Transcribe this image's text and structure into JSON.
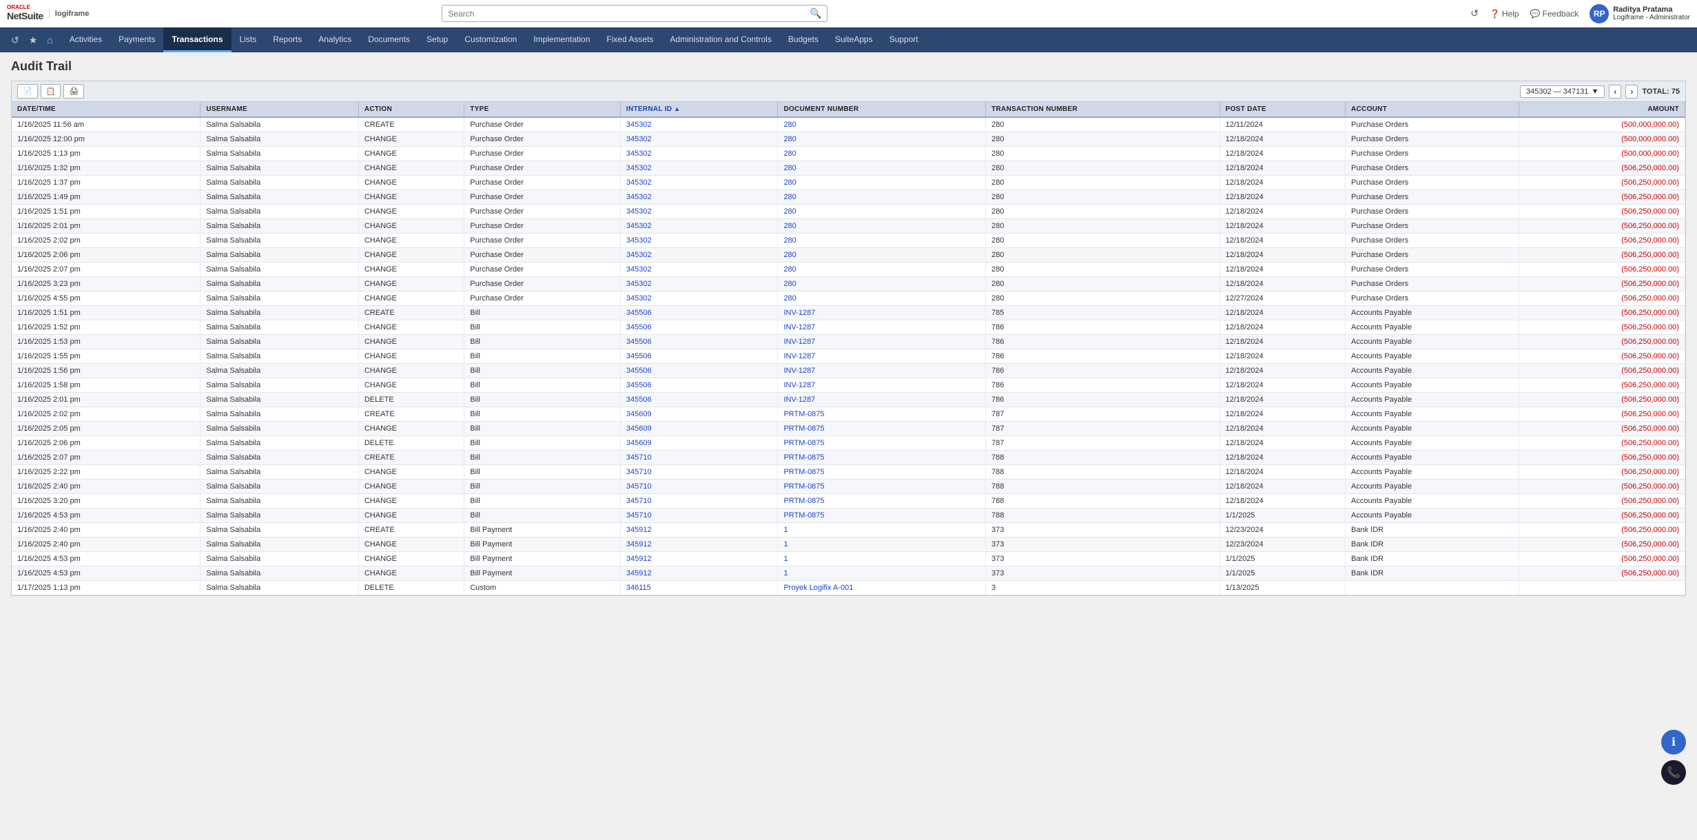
{
  "app": {
    "oracle_label": "ORACLE",
    "netsuite_label": "NetSuite",
    "logiframe_label": "logiframe"
  },
  "topbar": {
    "search_placeholder": "Search",
    "help_label": "Help",
    "feedback_label": "Feedback",
    "user_name": "Raditya Pratama",
    "user_role": "Logiframe - Administrator",
    "user_initials": "RP"
  },
  "nav": {
    "items": [
      {
        "id": "home",
        "label": "🏠",
        "is_icon": true
      },
      {
        "id": "activities",
        "label": "Activities"
      },
      {
        "id": "payments",
        "label": "Payments"
      },
      {
        "id": "transactions",
        "label": "Transactions",
        "active": true
      },
      {
        "id": "lists",
        "label": "Lists"
      },
      {
        "id": "reports",
        "label": "Reports"
      },
      {
        "id": "analytics",
        "label": "Analytics"
      },
      {
        "id": "documents",
        "label": "Documents"
      },
      {
        "id": "setup",
        "label": "Setup"
      },
      {
        "id": "customization",
        "label": "Customization"
      },
      {
        "id": "implementation",
        "label": "Implementation"
      },
      {
        "id": "fixed-assets",
        "label": "Fixed Assets"
      },
      {
        "id": "admin",
        "label": "Administration and Controls"
      },
      {
        "id": "budgets",
        "label": "Budgets"
      },
      {
        "id": "suiteapps",
        "label": "SuiteApps"
      },
      {
        "id": "support",
        "label": "Support"
      }
    ]
  },
  "page": {
    "title": "Audit Trail"
  },
  "toolbar": {
    "btn1_icon": "📄",
    "btn2_icon": "📋",
    "btn3_icon": "🖨",
    "page_range": "345302 — 347131",
    "total_label": "TOTAL: 75"
  },
  "table": {
    "columns": [
      {
        "id": "datetime",
        "label": "DATE/TIME",
        "sort": false
      },
      {
        "id": "username",
        "label": "USERNAME",
        "sort": false
      },
      {
        "id": "action",
        "label": "ACTION",
        "sort": false
      },
      {
        "id": "type",
        "label": "TYPE",
        "sort": false
      },
      {
        "id": "internal_id",
        "label": "INTERNAL ID",
        "sort": true
      },
      {
        "id": "document_number",
        "label": "DOCUMENT NUMBER",
        "sort": false
      },
      {
        "id": "transaction_number",
        "label": "TRANSACTION NUMBER",
        "sort": false
      },
      {
        "id": "post_date",
        "label": "POST DATE",
        "sort": false
      },
      {
        "id": "account",
        "label": "ACCOUNT",
        "sort": false
      },
      {
        "id": "amount",
        "label": "AMOUNT",
        "sort": false,
        "right": true
      }
    ],
    "rows": [
      {
        "datetime": "1/16/2025 11:56 am",
        "username": "Salma Salsabila",
        "action": "CREATE",
        "type": "Purchase Order",
        "internal_id": "345302",
        "document_number": "280",
        "transaction_number": "280",
        "post_date": "12/11/2024",
        "account": "Purchase Orders",
        "amount": "(500,000,000.00)"
      },
      {
        "datetime": "1/16/2025 12:00 pm",
        "username": "Salma Salsabila",
        "action": "CHANGE",
        "type": "Purchase Order",
        "internal_id": "345302",
        "document_number": "280",
        "transaction_number": "280",
        "post_date": "12/18/2024",
        "account": "Purchase Orders",
        "amount": "(500,000,000.00)"
      },
      {
        "datetime": "1/16/2025 1:13 pm",
        "username": "Salma Salsabila",
        "action": "CHANGE",
        "type": "Purchase Order",
        "internal_id": "345302",
        "document_number": "280",
        "transaction_number": "280",
        "post_date": "12/18/2024",
        "account": "Purchase Orders",
        "amount": "(500,000,000.00)"
      },
      {
        "datetime": "1/16/2025 1:32 pm",
        "username": "Salma Salsabila",
        "action": "CHANGE",
        "type": "Purchase Order",
        "internal_id": "345302",
        "document_number": "280",
        "transaction_number": "280",
        "post_date": "12/18/2024",
        "account": "Purchase Orders",
        "amount": "(506,250,000.00)"
      },
      {
        "datetime": "1/16/2025 1:37 pm",
        "username": "Salma Salsabila",
        "action": "CHANGE",
        "type": "Purchase Order",
        "internal_id": "345302",
        "document_number": "280",
        "transaction_number": "280",
        "post_date": "12/18/2024",
        "account": "Purchase Orders",
        "amount": "(506,250,000.00)"
      },
      {
        "datetime": "1/16/2025 1:49 pm",
        "username": "Salma Salsabila",
        "action": "CHANGE",
        "type": "Purchase Order",
        "internal_id": "345302",
        "document_number": "280",
        "transaction_number": "280",
        "post_date": "12/18/2024",
        "account": "Purchase Orders",
        "amount": "(506,250,000.00)"
      },
      {
        "datetime": "1/16/2025 1:51 pm",
        "username": "Salma Salsabila",
        "action": "CHANGE",
        "type": "Purchase Order",
        "internal_id": "345302",
        "document_number": "280",
        "transaction_number": "280",
        "post_date": "12/18/2024",
        "account": "Purchase Orders",
        "amount": "(506,250,000.00)"
      },
      {
        "datetime": "1/16/2025 2:01 pm",
        "username": "Salma Salsabila",
        "action": "CHANGE",
        "type": "Purchase Order",
        "internal_id": "345302",
        "document_number": "280",
        "transaction_number": "280",
        "post_date": "12/18/2024",
        "account": "Purchase Orders",
        "amount": "(506,250,000.00)"
      },
      {
        "datetime": "1/16/2025 2:02 pm",
        "username": "Salma Salsabila",
        "action": "CHANGE",
        "type": "Purchase Order",
        "internal_id": "345302",
        "document_number": "280",
        "transaction_number": "280",
        "post_date": "12/18/2024",
        "account": "Purchase Orders",
        "amount": "(506,250,000.00)"
      },
      {
        "datetime": "1/16/2025 2:06 pm",
        "username": "Salma Salsabila",
        "action": "CHANGE",
        "type": "Purchase Order",
        "internal_id": "345302",
        "document_number": "280",
        "transaction_number": "280",
        "post_date": "12/18/2024",
        "account": "Purchase Orders",
        "amount": "(506,250,000.00)"
      },
      {
        "datetime": "1/16/2025 2:07 pm",
        "username": "Salma Salsabila",
        "action": "CHANGE",
        "type": "Purchase Order",
        "internal_id": "345302",
        "document_number": "280",
        "transaction_number": "280",
        "post_date": "12/18/2024",
        "account": "Purchase Orders",
        "amount": "(506,250,000.00)"
      },
      {
        "datetime": "1/16/2025 3:23 pm",
        "username": "Salma Salsabila",
        "action": "CHANGE",
        "type": "Purchase Order",
        "internal_id": "345302",
        "document_number": "280",
        "transaction_number": "280",
        "post_date": "12/18/2024",
        "account": "Purchase Orders",
        "amount": "(506,250,000.00)"
      },
      {
        "datetime": "1/16/2025 4:55 pm",
        "username": "Salma Salsabila",
        "action": "CHANGE",
        "type": "Purchase Order",
        "internal_id": "345302",
        "document_number": "280",
        "transaction_number": "280",
        "post_date": "12/27/2024",
        "account": "Purchase Orders",
        "amount": "(506,250,000.00)"
      },
      {
        "datetime": "1/16/2025 1:51 pm",
        "username": "Salma Salsabila",
        "action": "CREATE",
        "type": "Bill",
        "internal_id": "345506",
        "document_number": "INV-1287",
        "transaction_number": "785",
        "post_date": "12/18/2024",
        "account": "Accounts Payable",
        "amount": "(506,250,000.00)"
      },
      {
        "datetime": "1/16/2025 1:52 pm",
        "username": "Salma Salsabila",
        "action": "CHANGE",
        "type": "Bill",
        "internal_id": "345506",
        "document_number": "INV-1287",
        "transaction_number": "786",
        "post_date": "12/18/2024",
        "account": "Accounts Payable",
        "amount": "(506,250,000.00)"
      },
      {
        "datetime": "1/16/2025 1:53 pm",
        "username": "Salma Salsabila",
        "action": "CHANGE",
        "type": "Bill",
        "internal_id": "345506",
        "document_number": "INV-1287",
        "transaction_number": "786",
        "post_date": "12/18/2024",
        "account": "Accounts Payable",
        "amount": "(506,250,000.00)"
      },
      {
        "datetime": "1/16/2025 1:55 pm",
        "username": "Salma Salsabila",
        "action": "CHANGE",
        "type": "Bill",
        "internal_id": "345506",
        "document_number": "INV-1287",
        "transaction_number": "786",
        "post_date": "12/18/2024",
        "account": "Accounts Payable",
        "amount": "(506,250,000.00)"
      },
      {
        "datetime": "1/16/2025 1:56 pm",
        "username": "Salma Salsabila",
        "action": "CHANGE",
        "type": "Bill",
        "internal_id": "345506",
        "document_number": "INV-1287",
        "transaction_number": "786",
        "post_date": "12/18/2024",
        "account": "Accounts Payable",
        "amount": "(506,250,000.00)"
      },
      {
        "datetime": "1/16/2025 1:58 pm",
        "username": "Salma Salsabila",
        "action": "CHANGE",
        "type": "Bill",
        "internal_id": "345506",
        "document_number": "INV-1287",
        "transaction_number": "786",
        "post_date": "12/18/2024",
        "account": "Accounts Payable",
        "amount": "(506,250,000.00)"
      },
      {
        "datetime": "1/16/2025 2:01 pm",
        "username": "Salma Salsabila",
        "action": "DELETE",
        "type": "Bill",
        "internal_id": "345506",
        "document_number": "INV-1287",
        "transaction_number": "786",
        "post_date": "12/18/2024",
        "account": "Accounts Payable",
        "amount": "(506,250,000.00)"
      },
      {
        "datetime": "1/16/2025 2:02 pm",
        "username": "Salma Salsabila",
        "action": "CREATE",
        "type": "Bill",
        "internal_id": "345609",
        "document_number": "PRTM-0875",
        "transaction_number": "787",
        "post_date": "12/18/2024",
        "account": "Accounts Payable",
        "amount": "(506,250,000.00)"
      },
      {
        "datetime": "1/16/2025 2:05 pm",
        "username": "Salma Salsabila",
        "action": "CHANGE",
        "type": "Bill",
        "internal_id": "345609",
        "document_number": "PRTM-0875",
        "transaction_number": "787",
        "post_date": "12/18/2024",
        "account": "Accounts Payable",
        "amount": "(506,250,000.00)"
      },
      {
        "datetime": "1/16/2025 2:06 pm",
        "username": "Salma Salsabila",
        "action": "DELETE",
        "type": "Bill",
        "internal_id": "345609",
        "document_number": "PRTM-0875",
        "transaction_number": "787",
        "post_date": "12/18/2024",
        "account": "Accounts Payable",
        "amount": "(506,250,000.00)"
      },
      {
        "datetime": "1/16/2025 2:07 pm",
        "username": "Salma Salsabila",
        "action": "CREATE",
        "type": "Bill",
        "internal_id": "345710",
        "document_number": "PRTM-0875",
        "transaction_number": "788",
        "post_date": "12/18/2024",
        "account": "Accounts Payable",
        "amount": "(506,250,000.00)"
      },
      {
        "datetime": "1/16/2025 2:22 pm",
        "username": "Salma Salsabila",
        "action": "CHANGE",
        "type": "Bill",
        "internal_id": "345710",
        "document_number": "PRTM-0875",
        "transaction_number": "788",
        "post_date": "12/18/2024",
        "account": "Accounts Payable",
        "amount": "(506,250,000.00)"
      },
      {
        "datetime": "1/16/2025 2:40 pm",
        "username": "Salma Salsabila",
        "action": "CHANGE",
        "type": "Bill",
        "internal_id": "345710",
        "document_number": "PRTM-0875",
        "transaction_number": "788",
        "post_date": "12/18/2024",
        "account": "Accounts Payable",
        "amount": "(506,250,000.00)"
      },
      {
        "datetime": "1/16/2025 3:20 pm",
        "username": "Salma Salsabila",
        "action": "CHANGE",
        "type": "Bill",
        "internal_id": "345710",
        "document_number": "PRTM-0875",
        "transaction_number": "788",
        "post_date": "12/18/2024",
        "account": "Accounts Payable",
        "amount": "(506,250,000.00)"
      },
      {
        "datetime": "1/16/2025 4:53 pm",
        "username": "Salma Salsabila",
        "action": "CHANGE",
        "type": "Bill",
        "internal_id": "345710",
        "document_number": "PRTM-0875",
        "transaction_number": "788",
        "post_date": "1/1/2025",
        "account": "Accounts Payable",
        "amount": "(506,250,000.00)"
      },
      {
        "datetime": "1/16/2025 2:40 pm",
        "username": "Salma Salsabila",
        "action": "CREATE",
        "type": "Bill Payment",
        "internal_id": "345912",
        "document_number": "1",
        "transaction_number": "373",
        "post_date": "12/23/2024",
        "account": "Bank IDR",
        "amount": "(506,250,000.00)"
      },
      {
        "datetime": "1/16/2025 2:40 pm",
        "username": "Salma Salsabila",
        "action": "CHANGE",
        "type": "Bill Payment",
        "internal_id": "345912",
        "document_number": "1",
        "transaction_number": "373",
        "post_date": "12/23/2024",
        "account": "Bank IDR",
        "amount": "(506,250,000.00)"
      },
      {
        "datetime": "1/16/2025 4:53 pm",
        "username": "Salma Salsabila",
        "action": "CHANGE",
        "type": "Bill Payment",
        "internal_id": "345912",
        "document_number": "1",
        "transaction_number": "373",
        "post_date": "1/1/2025",
        "account": "Bank IDR",
        "amount": "(506,250,000.00)"
      },
      {
        "datetime": "1/16/2025 4:53 pm",
        "username": "Salma Salsabila",
        "action": "CHANGE",
        "type": "Bill Payment",
        "internal_id": "345912",
        "document_number": "1",
        "transaction_number": "373",
        "post_date": "1/1/2025",
        "account": "Bank IDR",
        "amount": "(506,250,000.00)"
      },
      {
        "datetime": "1/17/2025 1:13 pm",
        "username": "Salma Salsabila",
        "action": "DELETE",
        "type": "Custom",
        "internal_id": "346115",
        "document_number": "Proyek Logifix A-001",
        "transaction_number": "3",
        "post_date": "1/13/2025",
        "account": "",
        "amount": ""
      }
    ]
  }
}
